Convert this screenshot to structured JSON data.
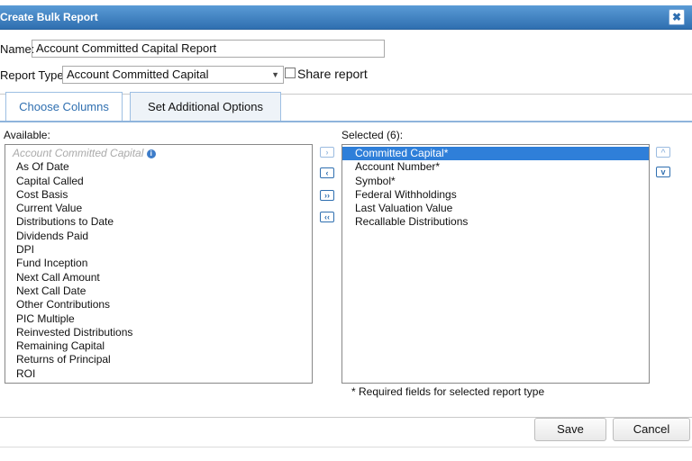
{
  "dialog": {
    "title": "Create Bulk Report",
    "close_glyph": "✖",
    "close_icon": "close-icon"
  },
  "form": {
    "name_label": "Name:",
    "name_value": "Account Committed Capital Report",
    "report_type_label": "Report Type:",
    "report_type_value": "Account Committed Capital",
    "share_label": "Share report",
    "share_checked": false
  },
  "tabs": [
    {
      "label": "Choose Columns"
    },
    {
      "label": "Set Additional Options"
    }
  ],
  "available": {
    "label": "Available:",
    "group": "Account Committed Capital",
    "items": [
      "As Of Date",
      "Capital Called",
      "Cost Basis",
      "Current Value",
      "Distributions to Date",
      "Dividends Paid",
      "DPI",
      "Fund Inception",
      "Next Call Amount",
      "Next Call Date",
      "Other Contributions",
      "PIC Multiple",
      "Reinvested Distributions",
      "Remaining Capital",
      "Returns of Principal",
      "ROI"
    ]
  },
  "selected": {
    "label": "Selected (6):",
    "items": [
      "Committed Capital*",
      "Account Number*",
      "Symbol*",
      "Federal Withholdings",
      "Last Valuation Value",
      "Recallable Distributions"
    ]
  },
  "move_buttons": {
    "add": "›",
    "remove": "‹",
    "add_all": "››",
    "remove_all": "‹‹",
    "up": "^",
    "down": "v"
  },
  "note": "* Required fields for selected report type",
  "buttons": {
    "save": "Save",
    "cancel": "Cancel"
  },
  "colors": {
    "titlebar": "#2f6fb0",
    "selection": "#2f7fd9",
    "link": "#2f6fb0"
  }
}
